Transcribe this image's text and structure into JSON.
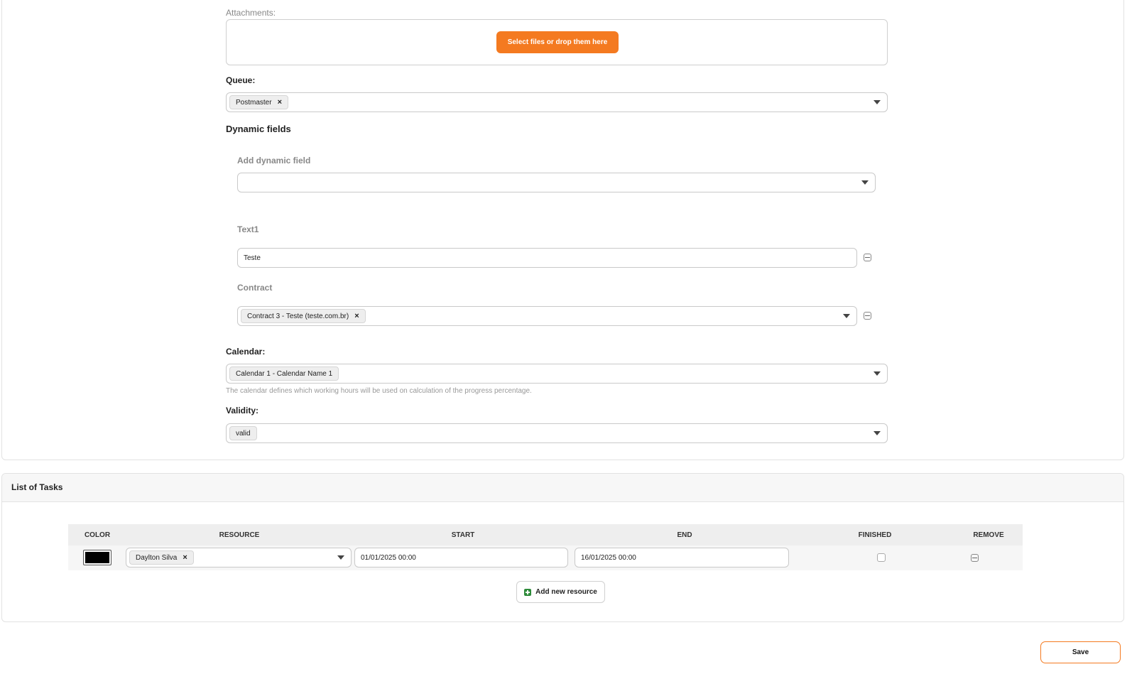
{
  "attachments": {
    "label": "Attachments:",
    "upload_button": "Select files or drop them here"
  },
  "queue": {
    "label": "Queue:",
    "selected": "Postmaster",
    "remove_symbol": "×"
  },
  "dynamic_fields": {
    "heading": "Dynamic fields",
    "add_label": "Add dynamic field",
    "add_value": "",
    "fields": [
      {
        "label": "Text1",
        "value": "Teste"
      },
      {
        "label": "Contract",
        "selected": "Contract 3 - Teste (teste.com.br)",
        "remove_symbol": "×"
      }
    ]
  },
  "calendar": {
    "label": "Calendar:",
    "selected": "Calendar 1 - Calendar Name 1",
    "hint": "The calendar defines which working hours will be used on calculation of the progress percentage."
  },
  "validity": {
    "label": "Validity:",
    "selected": "valid"
  },
  "tasks": {
    "title": "List of Tasks",
    "columns": [
      "COLOR",
      "RESOURCE",
      "START",
      "END",
      "FINISHED",
      "REMOVE"
    ],
    "rows": [
      {
        "color": "#000000",
        "resource": "Daylton Silva",
        "remove_symbol": "×",
        "start": "01/01/2025 00:00",
        "end": "16/01/2025 00:00",
        "finished": false
      }
    ],
    "add_button": "Add new resource"
  },
  "save_button": "Save",
  "colors": {
    "accent": "#f47a20",
    "add_icon": "#2e8b3a"
  }
}
